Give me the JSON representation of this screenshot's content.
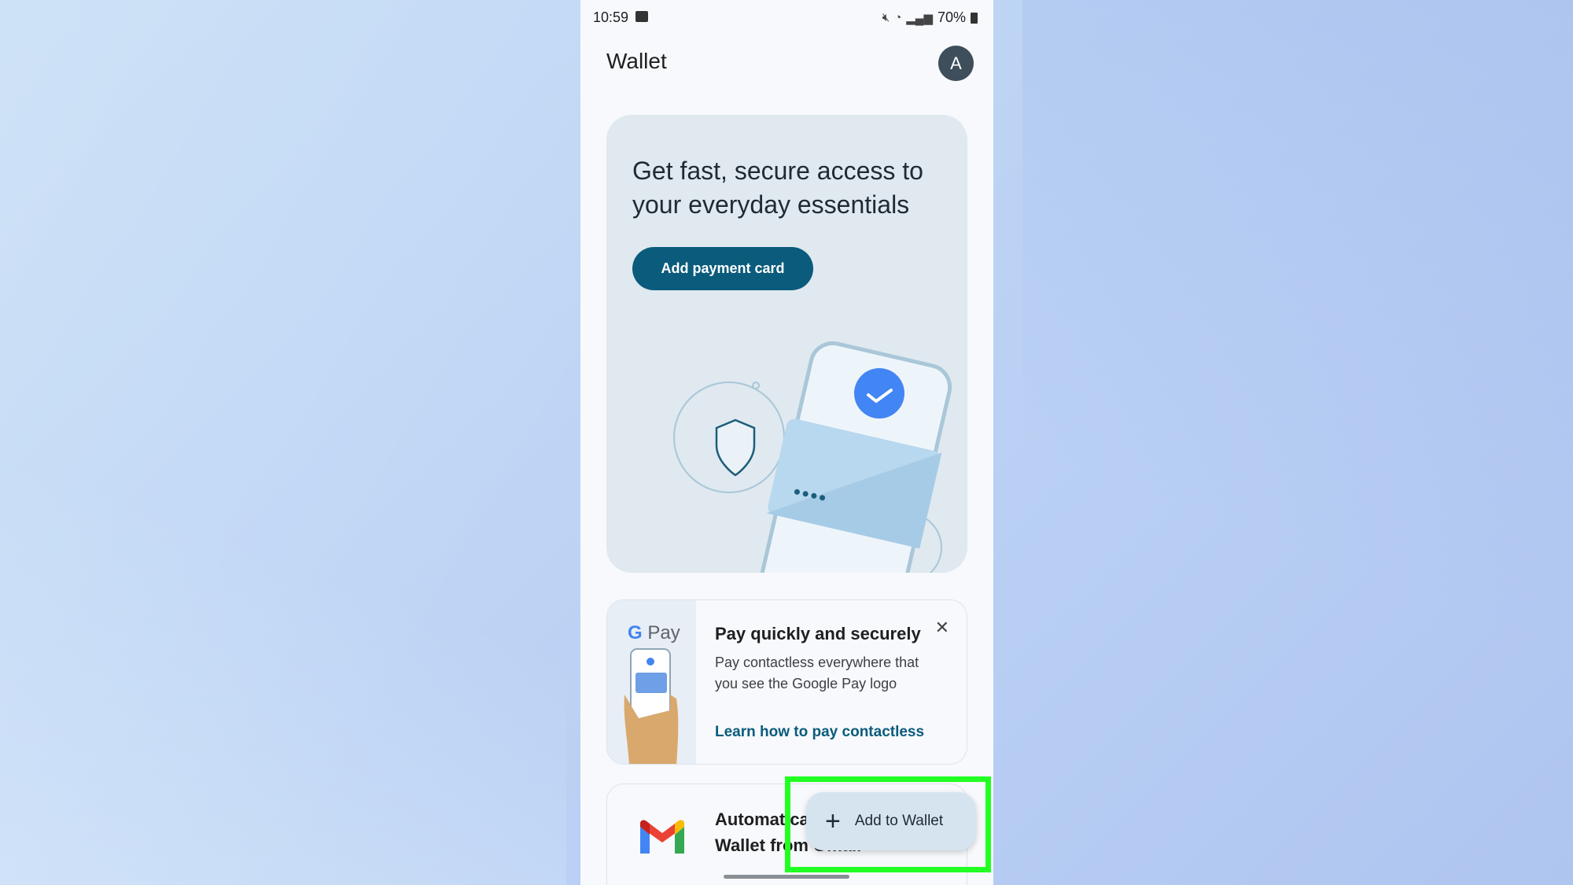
{
  "status_bar": {
    "time": "10:59",
    "battery": "70%",
    "icons": [
      "image-icon",
      "mute-icon",
      "wifi-icon",
      "signal-icon",
      "battery-icon"
    ]
  },
  "header": {
    "title": "Wallet",
    "avatar_letter": "A"
  },
  "hero": {
    "title": "Get fast, secure access to your everyday essentials",
    "button_label": "Add payment card"
  },
  "gpay_card": {
    "logo_g": "G",
    "logo_text": "Pay",
    "title": "Pay quickly and securely",
    "body": "Pay contactless everywhere that you see the Google Pay logo",
    "link": "Learn how to pay contactless",
    "close_icon": "close-icon"
  },
  "gmail_card": {
    "text": "Automatically add passes to Wallet from Gmail"
  },
  "fab": {
    "label": "Add to Wallet",
    "icon": "plus-icon"
  },
  "colors": {
    "accent": "#0b5b7c",
    "highlight": "#22ff22",
    "hero_bg": "#dfe9ef"
  }
}
